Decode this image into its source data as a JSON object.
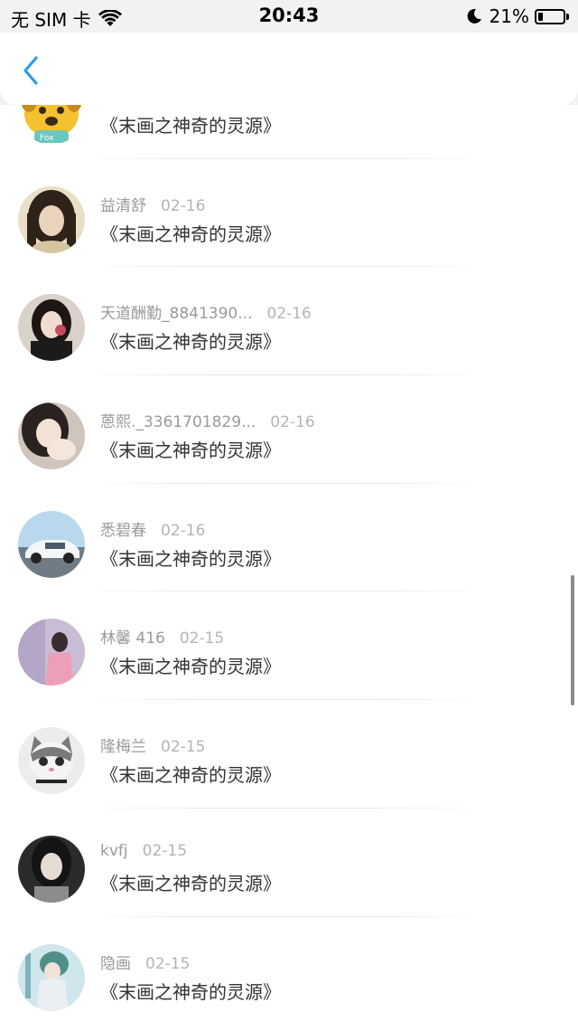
{
  "status_bar": {
    "carrier": "无 SIM 卡",
    "time": "20:43",
    "battery_percent": "21%",
    "battery_level": 0.21,
    "icons": [
      "wifi-icon",
      "moon-icon",
      "battery-icon"
    ]
  },
  "nav": {
    "back_icon": "chevron-left-icon",
    "accent_color": "#2f9be8"
  },
  "list": {
    "items": [
      {
        "user": "",
        "date": "",
        "title": "《末画之神奇的灵源》",
        "avatar": "cartoon-dog-avatar"
      },
      {
        "user": "益清舒",
        "date": "02-16",
        "title": "《末画之神奇的灵源》",
        "avatar": "girl-avatar"
      },
      {
        "user": "天道酬勤_8841390...",
        "date": "02-16",
        "title": "《末画之神奇的灵源》",
        "avatar": "girl-flower-avatar"
      },
      {
        "user": "蒽熙._3361701829...",
        "date": "02-16",
        "title": "《末画之神奇的灵源》",
        "avatar": "girl-hand-avatar"
      },
      {
        "user": "悉碧春",
        "date": "02-16",
        "title": "《末画之神奇的灵源》",
        "avatar": "car-avatar"
      },
      {
        "user": "林馨 416",
        "date": "02-15",
        "title": "《末画之神奇的灵源》",
        "avatar": "pink-girl-avatar"
      },
      {
        "user": "隆梅兰",
        "date": "02-15",
        "title": "《末画之神奇的灵源》",
        "avatar": "cat-avatar"
      },
      {
        "user": "kvfj",
        "date": "02-15",
        "title": "《末画之神奇的灵源》",
        "avatar": "dark-hair-girl-avatar"
      },
      {
        "user": "隐画",
        "date": "02-15",
        "title": "《末画之神奇的灵源》",
        "avatar": "anime-girl-avatar"
      }
    ]
  }
}
